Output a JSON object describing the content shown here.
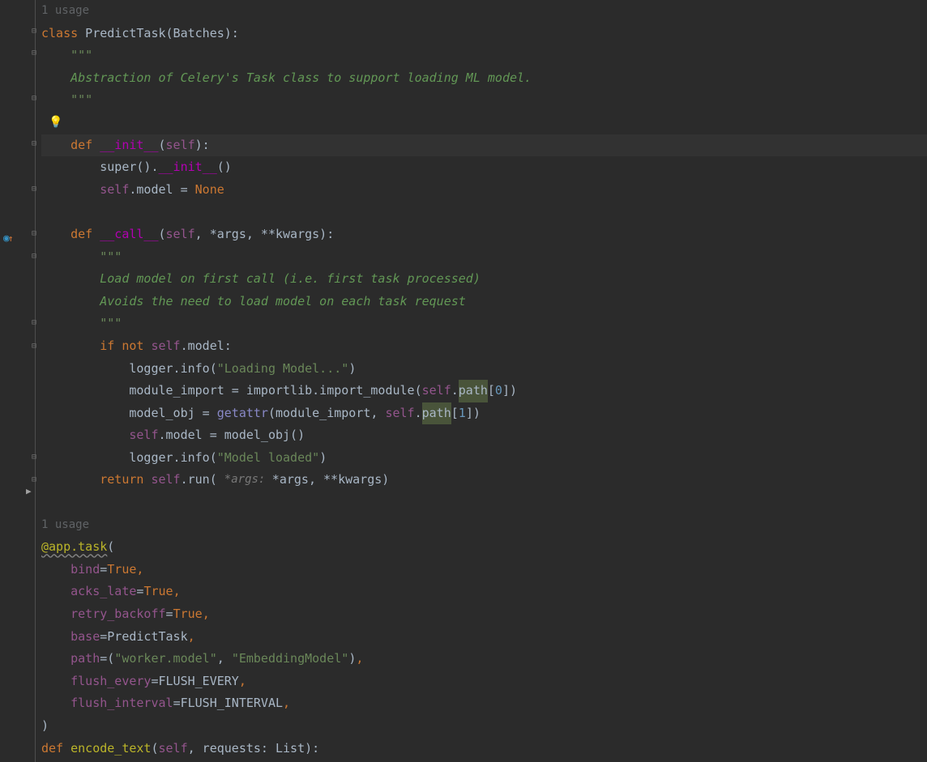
{
  "hints": {
    "usage1": "1 usage",
    "usage2": "1 usage"
  },
  "code": {
    "l01": "class",
    "l01b": " PredictTask(Batches):",
    "l02": "    \"\"\"",
    "l03": "    Abstraction of Celery's Task class to support loading ML model.",
    "l04": "    \"\"\"",
    "l06a": "    def ",
    "l06b": "__init__",
    "l06c": "(",
    "l06d": "self",
    "l06e": "):",
    "l07a": "        super().",
    "l07b": "__init__",
    "l07c": "()",
    "l08a": "        ",
    "l08self": "self",
    "l08b": ".model = ",
    "l08none": "None",
    "l10a": "    def ",
    "l10b": "__call__",
    "l10c": "(",
    "l10self": "self",
    "l10d": ", *args, **kwargs):",
    "l11": "        \"\"\"",
    "l12": "        Load model on first call (i.e. first task processed)",
    "l13": "        Avoids the need to load model on each task request",
    "l14": "        \"\"\"",
    "l15a": "        if ",
    "l15not": "not ",
    "l15self": "self",
    "l15b": ".model:",
    "l16a": "            logger.info(",
    "l16s": "\"Loading Model...\"",
    "l16b": ")",
    "l17a": "            module_import = importlib.import_module(",
    "l17self": "self",
    "l17b": ".",
    "l17path": "path",
    "l17c": "[",
    "l17n": "0",
    "l17d": "])",
    "l18a": "            model_obj = ",
    "l18fn": "getattr",
    "l18b": "(module_import, ",
    "l18self": "self",
    "l18c": ".",
    "l18path": "path",
    "l18d": "[",
    "l18n": "1",
    "l18e": "])",
    "l19a": "            ",
    "l19self": "self",
    "l19b": ".model = model_obj()",
    "l20a": "            logger.info(",
    "l20s": "\"Model loaded\"",
    "l20b": ")",
    "l21a": "        return ",
    "l21self": "self",
    "l21b": ".run( ",
    "l21hint": "*args: ",
    "l21c": "*args, **kwargs)",
    "l24": "@app.task",
    "l24b": "(",
    "l25a": "    ",
    "l25k": "bind",
    "l25v": "=",
    "l25t": "True",
    "l25c": ",",
    "l26k": "acks_late",
    "l26t": "True",
    "l27k": "retry_backoff",
    "l27t": "True",
    "l28k": "base",
    "l28v": "=PredictTask",
    "l29k": "path",
    "l29v": "=(",
    "l29s1": "\"worker.model\"",
    "l29m": ", ",
    "l29s2": "\"EmbeddingModel\"",
    "l29e": ")",
    "l30k": "flush_every",
    "l30v": "=FLUSH_EVERY",
    "l31k": "flush_interval",
    "l31v": "=FLUSH_INTERVAL",
    "l32": ")",
    "l33a": "def ",
    "l33b": "encode_text",
    "l33c": "(",
    "l33self": "self",
    "l33d": ", requests: List):"
  }
}
